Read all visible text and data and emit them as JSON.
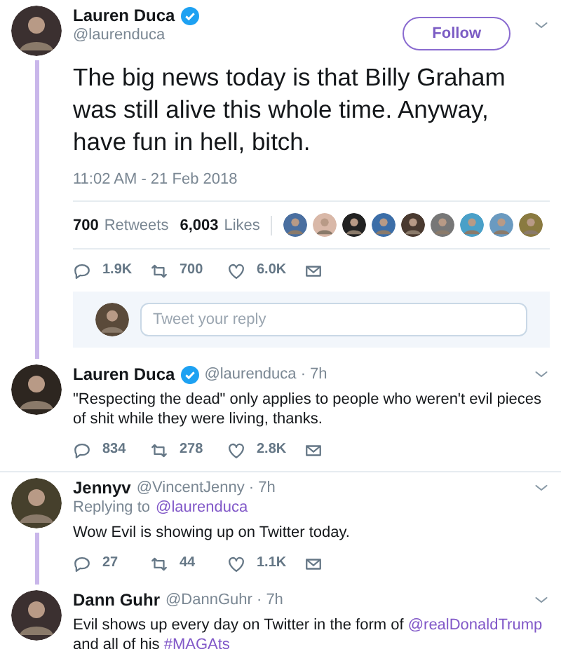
{
  "main_tweet": {
    "name": "Lauren Duca",
    "verified": true,
    "handle": "@laurenduca",
    "follow_button": "Follow",
    "thread_line": true,
    "text": "The big news today is that Billy Graham was still alive this whole time. Anyway, have fun in hell, bitch.",
    "timestamp": "11:02 AM - 21 Feb 2018",
    "retweets": {
      "count": "700",
      "label": "Retweets"
    },
    "likes": {
      "count": "6,003",
      "label": "Likes"
    },
    "actions": {
      "replies": "1.9K",
      "retweets": "700",
      "likes": "6.0K"
    }
  },
  "reply_box": {
    "placeholder": "Tweet your reply"
  },
  "replies": [
    {
      "name": "Lauren Duca",
      "verified": true,
      "meta": "@laurenduca · 7h",
      "thread_line": false,
      "text": [
        {
          "kind": "plain",
          "text": "\"Respecting the dead\" only applies to people who weren't evil pieces of shit while they were living, thanks."
        }
      ],
      "actions": {
        "replies": "834",
        "retweets": "278",
        "likes": "2.8K"
      }
    },
    {
      "name": "Jennyv",
      "verified": false,
      "meta": "@VincentJenny · 7h",
      "thread_line": true,
      "replying_to": {
        "label": "Replying to",
        "handle": "@laurenduca"
      },
      "text": [
        {
          "kind": "plain",
          "text": "Wow Evil is showing up on Twitter today."
        }
      ],
      "actions": {
        "replies": "27",
        "retweets": "44",
        "likes": "1.1K"
      }
    },
    {
      "name": "Dann Guhr",
      "verified": false,
      "meta": "@DannGuhr · 7h",
      "thread_line": false,
      "text": [
        {
          "kind": "plain",
          "text": "Evil shows up every day on Twitter in the form of "
        },
        {
          "kind": "link",
          "text": "@realDonaldTrump"
        },
        {
          "kind": "plain",
          "text": " and all of his "
        },
        {
          "kind": "link",
          "text": "#MAGAts"
        }
      ]
    }
  ]
}
